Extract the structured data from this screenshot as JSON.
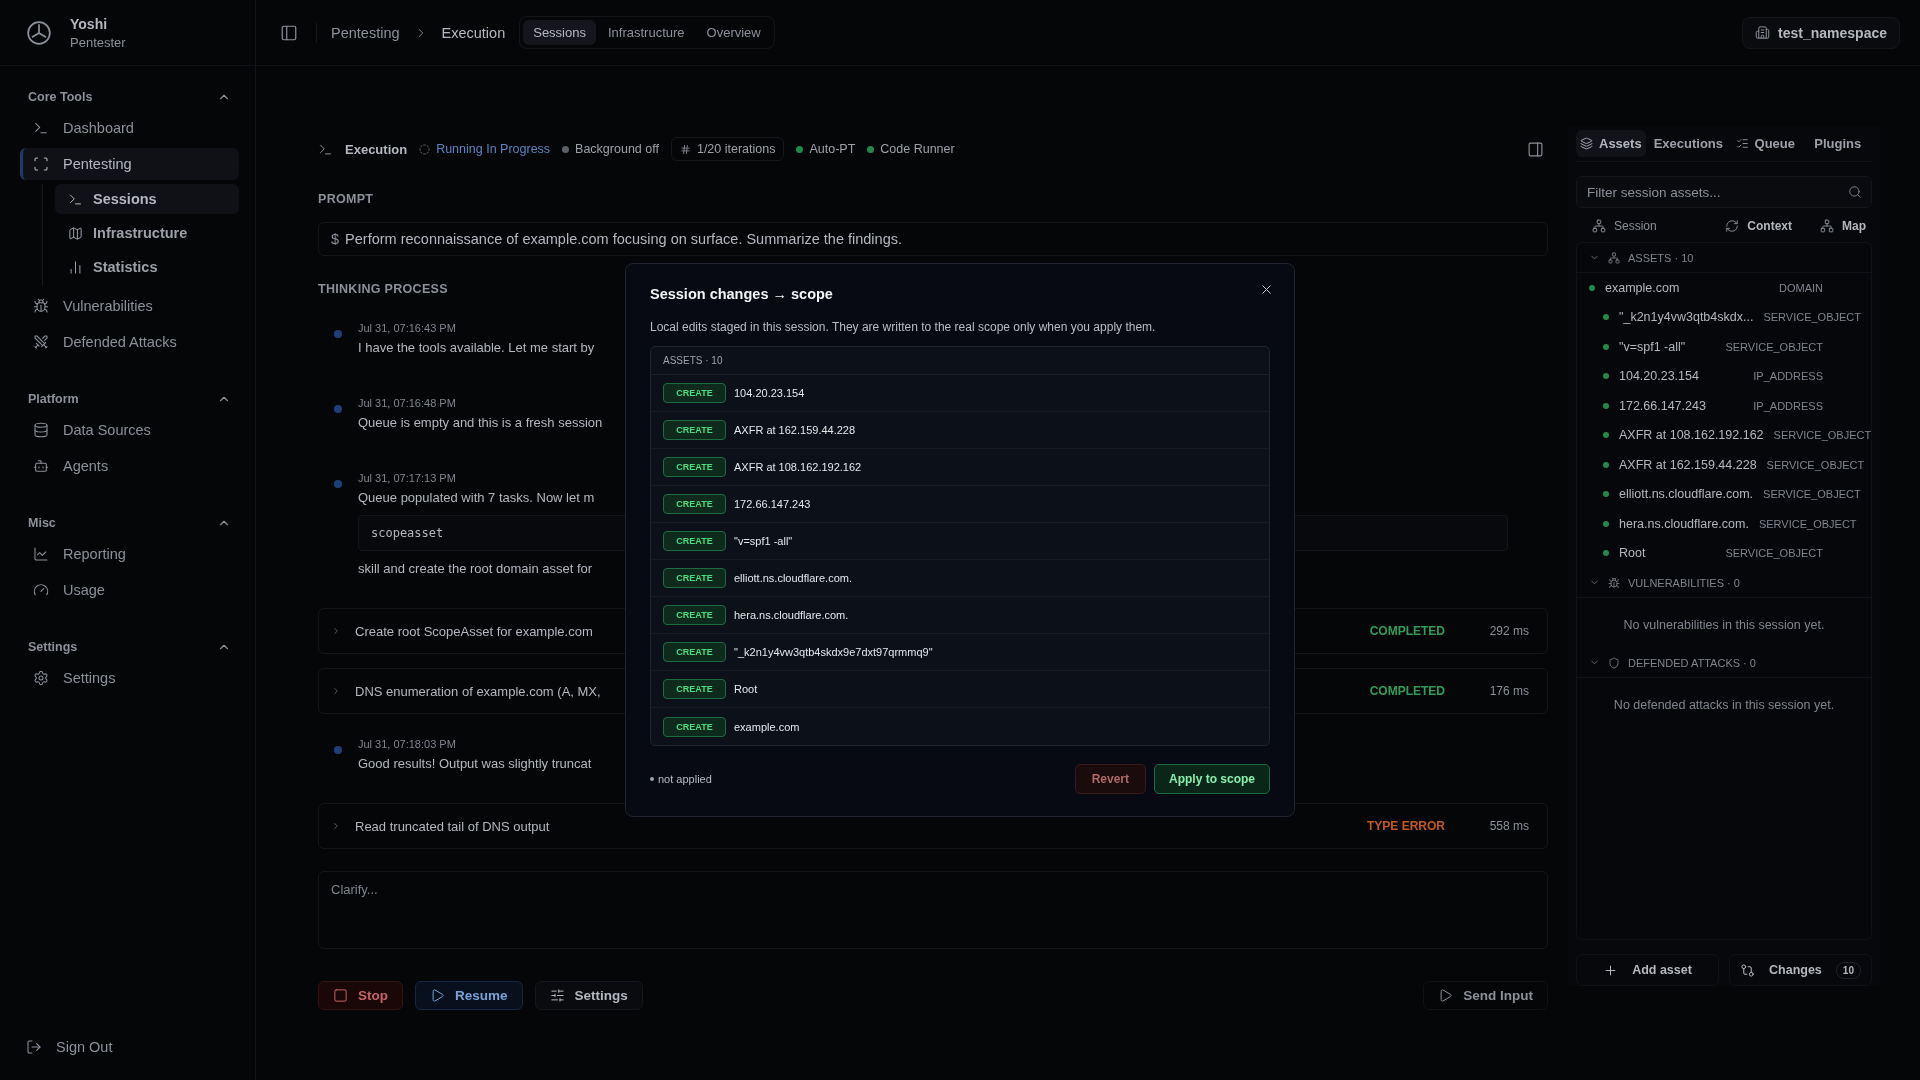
{
  "user": {
    "name": "Yoshi",
    "role": "Pentester"
  },
  "sidebar": {
    "sections": [
      {
        "title": "Core Tools",
        "expanded": true,
        "items": [
          {
            "label": "Dashboard",
            "selected": false
          },
          {
            "label": "Pentesting",
            "selected": true,
            "children": [
              {
                "label": "Sessions",
                "selected": true
              },
              {
                "label": "Infrastructure",
                "selected": false
              },
              {
                "label": "Statistics",
                "selected": false
              }
            ]
          },
          {
            "label": "Vulnerabilities",
            "selected": false
          },
          {
            "label": "Defended Attacks",
            "selected": false
          }
        ]
      },
      {
        "title": "Platform",
        "expanded": true,
        "items": [
          {
            "label": "Data Sources",
            "selected": false
          },
          {
            "label": "Agents",
            "selected": false
          }
        ]
      },
      {
        "title": "Misc",
        "expanded": true,
        "items": [
          {
            "label": "Reporting",
            "selected": false
          },
          {
            "label": "Usage",
            "selected": false
          }
        ]
      },
      {
        "title": "Settings",
        "expanded": true,
        "items": [
          {
            "label": "Settings",
            "selected": false
          }
        ]
      }
    ],
    "sign_out": "Sign Out"
  },
  "breadcrumb": [
    "Pentesting",
    "Execution"
  ],
  "view_tabs": [
    {
      "label": "Sessions",
      "selected": true
    },
    {
      "label": "Infrastructure",
      "selected": false
    },
    {
      "label": "Overview",
      "selected": false
    }
  ],
  "namespace": "test_namespace",
  "session_header": {
    "title": "Execution",
    "chips": [
      {
        "kind": "status",
        "label": "Running In Progress"
      },
      {
        "kind": "dot",
        "label": "Background off",
        "color": "#5b5f68"
      },
      {
        "kind": "count",
        "label": "1/20 iterations"
      },
      {
        "kind": "dot",
        "label": "Auto-PT",
        "color": "#1f8a4c"
      },
      {
        "kind": "dot",
        "label": "Code Runner",
        "color": "#1f8a4c"
      }
    ]
  },
  "prompt": {
    "label": "PROMPT",
    "prefix": "$",
    "text": "Perform reconnaissance of example.com focusing on surface. Summarize the findings."
  },
  "thinking": {
    "label": "THINKING PROCESS",
    "entries": [
      {
        "kind": "thought",
        "time": "Jul 31, 07:16:43 PM",
        "text": "I have the tools available. Let me start by"
      },
      {
        "kind": "thought",
        "time": "Jul 31, 07:16:48 PM",
        "text": "Queue is empty and this is a fresh session"
      },
      {
        "kind": "thought",
        "time": "Jul 31, 07:17:13 PM",
        "text": "Queue populated with 7 tasks. Now let m",
        "code": "scopeasset",
        "after": "skill and create the root domain asset for"
      },
      {
        "kind": "task",
        "title": "Create root ScopeAsset for example.com",
        "status": "COMPLETED",
        "color": "#2f9e5b",
        "duration": "292 ms"
      },
      {
        "kind": "task",
        "title": "DNS enumeration of example.com (A, MX,",
        "status": "COMPLETED",
        "color": "#2f9e5b",
        "duration": "176 ms"
      },
      {
        "kind": "thought",
        "time": "Jul 31, 07:18:03 PM",
        "text": "Good results! Output was slightly truncat"
      },
      {
        "kind": "task",
        "title": "Read truncated tail of DNS output",
        "status": "TYPE ERROR",
        "color": "#c2591d",
        "duration": "558 ms"
      }
    ]
  },
  "input": {
    "placeholder": "Clarify..."
  },
  "actions": [
    {
      "kind": "danger",
      "label": "Stop"
    },
    {
      "kind": "primary",
      "label": "Resume"
    },
    {
      "kind": "plain",
      "label": "Settings"
    }
  ],
  "send": "Send Input",
  "panel": {
    "tabs": [
      {
        "label": "Assets",
        "selected": true
      },
      {
        "label": "Executions",
        "selected": false
      },
      {
        "label": "Queue",
        "selected": false
      },
      {
        "label": "Plugins",
        "selected": false
      }
    ],
    "filter": {
      "placeholder": "Filter session assets..."
    },
    "modes": [
      "Session",
      "Context",
      "Map"
    ],
    "groups": [
      {
        "title": "ASSETS · 10",
        "expanded": true,
        "items": [
          {
            "name": "example.com",
            "type": "DOMAIN",
            "children": [
              {
                "name": "\"_k2n1y4vw3qtb4skdx...",
                "type": "SERVICE_OBJECT"
              },
              {
                "name": "\"v=spf1 -all\"",
                "type": "SERVICE_OBJECT"
              },
              {
                "name": "104.20.23.154",
                "type": "IP_ADDRESS"
              },
              {
                "name": "172.66.147.243",
                "type": "IP_ADDRESS"
              },
              {
                "name": "AXFR at 108.162.192.162",
                "type": "SERVICE_OBJECT"
              },
              {
                "name": "AXFR at 162.159.44.228",
                "type": "SERVICE_OBJECT"
              },
              {
                "name": "elliott.ns.cloudflare.com.",
                "type": "SERVICE_OBJECT"
              },
              {
                "name": "hera.ns.cloudflare.com.",
                "type": "SERVICE_OBJECT"
              },
              {
                "name": "Root",
                "type": "SERVICE_OBJECT"
              }
            ]
          }
        ]
      },
      {
        "title": "VULNERABILITIES · 0",
        "expanded": true,
        "empty": "No vulnerabilities in this session yet."
      },
      {
        "title": "DEFENDED ATTACKS · 0",
        "expanded": true,
        "empty": "No defended attacks in this session yet."
      }
    ],
    "footer": {
      "add": "Add asset",
      "changes": "Changes",
      "count": "10"
    }
  },
  "dialog": {
    "title": "Session changes → scope",
    "description": "Local edits staged in this session. They are written to the real scope only when you apply them.",
    "list_header": "ASSETS · 10",
    "rows": [
      {
        "action": "CREATE",
        "name": "104.20.23.154"
      },
      {
        "action": "CREATE",
        "name": "AXFR at 162.159.44.228"
      },
      {
        "action": "CREATE",
        "name": "AXFR at 108.162.192.162"
      },
      {
        "action": "CREATE",
        "name": "172.66.147.243"
      },
      {
        "action": "CREATE",
        "name": "\"v=spf1 -all\""
      },
      {
        "action": "CREATE",
        "name": "elliott.ns.cloudflare.com."
      },
      {
        "action": "CREATE",
        "name": "hera.ns.cloudflare.com."
      },
      {
        "action": "CREATE",
        "name": "\"_k2n1y4vw3qtb4skdx9e7dxt97qrmmq9\""
      },
      {
        "action": "CREATE",
        "name": "Root"
      },
      {
        "action": "CREATE",
        "name": "example.com"
      }
    ],
    "status": "not applied",
    "revert": "Revert",
    "apply": "Apply to scope"
  }
}
